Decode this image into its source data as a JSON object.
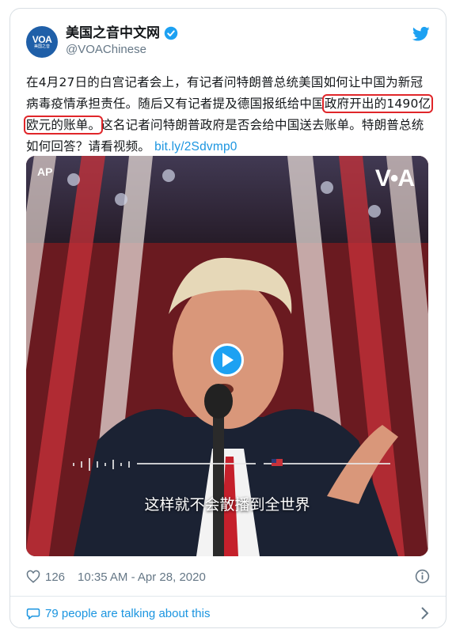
{
  "account": {
    "display_name": "美国之音中文网",
    "handle": "@VOAChinese",
    "avatar_text": "VOA",
    "avatar_subtext": "美国之音"
  },
  "tweet": {
    "text_before": "在4月27日的白宫记者会上，有记者问特朗普总统美国如何让中国为新冠病毒疫情承担责任。随后又有记者提及德国报纸给中国",
    "text_highlight": "政府开出的1490亿欧元的账单。",
    "text_after": "这名记者问特朗普政府是否会给中国送去账单。特朗普总统如何回答？请看视频。",
    "link": "bit.ly/2Sdvmp0"
  },
  "media": {
    "credit": "AP",
    "watermark": "V•A",
    "subtitle": "这样就不会散播到全世界"
  },
  "stats": {
    "likes": "126",
    "timestamp": "10:35 AM - Apr 28, 2020"
  },
  "footer": {
    "conversation": "79 people are talking about this"
  },
  "colors": {
    "brand_blue": "#1da1f2",
    "link_blue": "#1b95e0",
    "highlight_red": "#e0262a"
  }
}
